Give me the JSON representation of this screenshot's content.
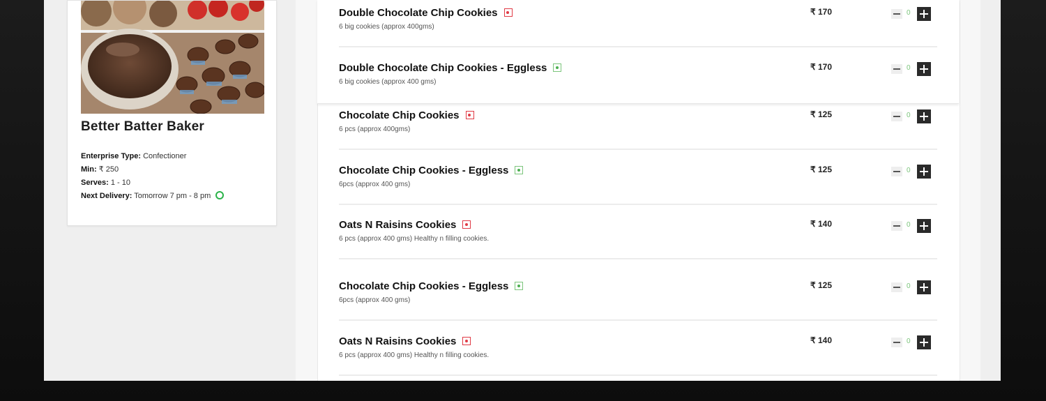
{
  "baker": {
    "name": "Better Batter Baker",
    "enterprise_label": "Enterprise Type:",
    "enterprise_value": "Confectioner",
    "min_label": "Min:",
    "min_value": "₹ 250",
    "serves_label": "Serves:",
    "serves_value": "1 - 10",
    "delivery_label": "Next Delivery:",
    "delivery_value": "Tomorrow 7 pm - 8 pm",
    "image": "cakes-and-cookies-photo"
  },
  "menu": {
    "items": [
      {
        "name": "Double Chocolate Chip Cookies",
        "type": "non-veg",
        "desc": "6 big cookies (approx 400gms)",
        "price": "₹ 170",
        "qty": "0"
      },
      {
        "name": "Double Chocolate Chip Cookies - Eggless",
        "type": "veg",
        "desc": "6 big cookies (approx 400 gms)",
        "price": "₹ 170",
        "qty": "0"
      },
      {
        "name": "Chocolate Chip Cookies",
        "type": "non-veg",
        "desc": "6 pcs (approx 400gms)",
        "price": "₹ 125",
        "qty": "0"
      },
      {
        "name": "Chocolate Chip Cookies - Eggless",
        "type": "veg",
        "desc": "6pcs (approx 400 gms)",
        "price": "₹ 125",
        "qty": "0"
      },
      {
        "name": "Oats N Raisins Cookies",
        "type": "non-veg",
        "desc": "6 pcs (approx 400 gms) Healthy n filling cookies.",
        "price": "₹ 140",
        "qty": "0"
      },
      {
        "name": "Chocolate Chip Cookies - Eggless",
        "type": "veg",
        "desc": "6pcs (approx 400 gms)",
        "price": "₹ 125",
        "qty": "0"
      },
      {
        "name": "Oats N Raisins Cookies",
        "type": "non-veg",
        "desc": "6 pcs (approx 400 gms) Healthy n filling cookies.",
        "price": "₹ 140",
        "qty": "0"
      }
    ]
  },
  "colors": {
    "non_veg": "#e03a45",
    "veg": "#4caf50",
    "delivery_indicator": "#2bb34a"
  }
}
